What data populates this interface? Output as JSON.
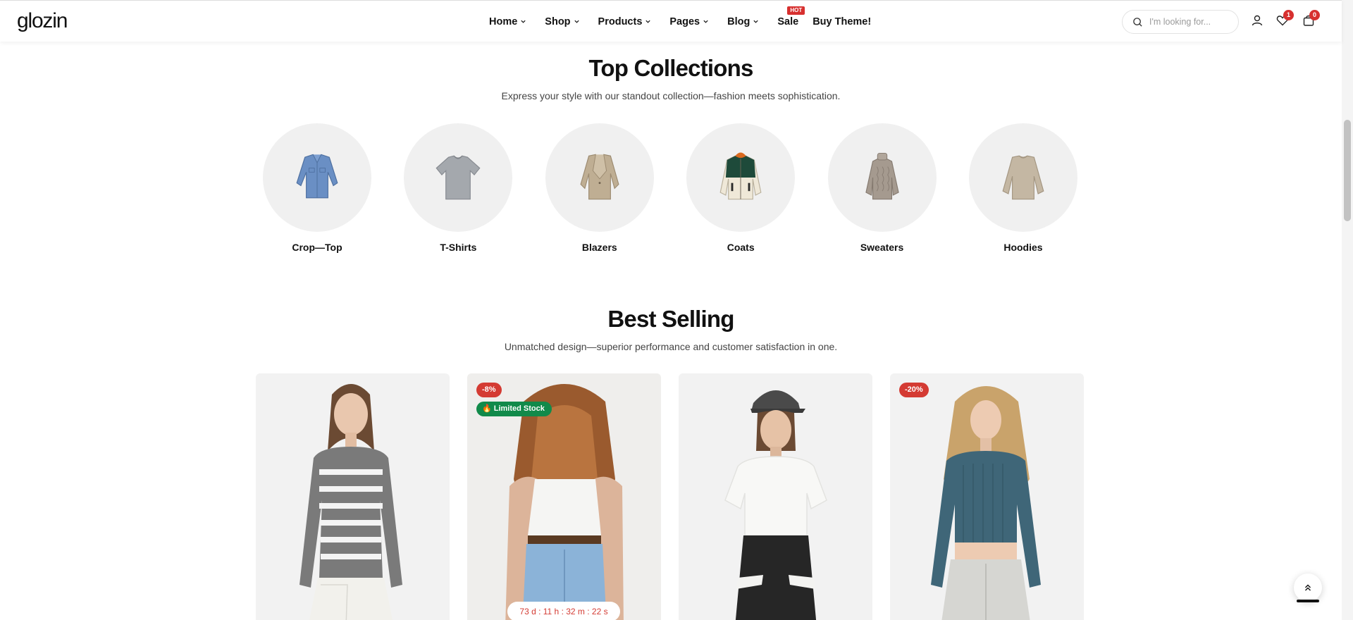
{
  "header": {
    "logo": "glozin",
    "nav": [
      {
        "label": "Home",
        "dropdown": true
      },
      {
        "label": "Shop",
        "dropdown": true
      },
      {
        "label": "Products",
        "dropdown": true
      },
      {
        "label": "Pages",
        "dropdown": true
      },
      {
        "label": "Blog",
        "dropdown": true
      },
      {
        "label": "Sale",
        "dropdown": false,
        "badge": "HOT"
      },
      {
        "label": "Buy Theme!",
        "dropdown": false
      }
    ],
    "search_placeholder": "I'm looking for...",
    "wishlist_count": "1",
    "cart_count": "0"
  },
  "collections": {
    "title": "Top Collections",
    "subtitle": "Express your style with our standout collection—fashion meets sophistication.",
    "items": [
      {
        "label": "Crop—Top",
        "icon": "denim-jacket-icon",
        "color": "#6a8fc4"
      },
      {
        "label": "T-Shirts",
        "icon": "gray-tshirt-icon",
        "color": "#a4a8ad"
      },
      {
        "label": "Blazers",
        "icon": "beige-blazer-icon",
        "color": "#bfae93"
      },
      {
        "label": "Coats",
        "icon": "fleece-coat-icon",
        "color": "#1e4a3a"
      },
      {
        "label": "Sweaters",
        "icon": "knit-sweater-icon",
        "color": "#a59a8f"
      },
      {
        "label": "Hoodies",
        "icon": "beige-sweatshirt-icon",
        "color": "#c4b7a3"
      }
    ]
  },
  "best_selling": {
    "title": "Best Selling",
    "subtitle": "Unmatched design—superior performance and customer satisfaction in one.",
    "products": [
      {
        "name": "striped-top-product",
        "badge": null
      },
      {
        "name": "white-tank-product",
        "badge": "-8%",
        "stock_label": "🔥 Limited Stock",
        "countdown": "73 d  :  11 h  :  32 m  :  22 s"
      },
      {
        "name": "white-tee-product",
        "badge": null
      },
      {
        "name": "ribbed-crop-product",
        "badge": "-20%"
      }
    ]
  },
  "colors": {
    "accent_red": "#d43b33",
    "stock_green": "#118a4a"
  }
}
